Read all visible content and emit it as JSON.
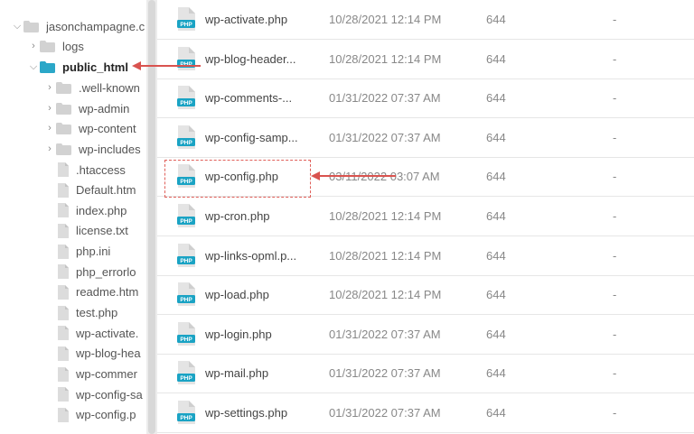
{
  "sidebar": {
    "root": "jasonchampagne.c",
    "logs": "logs",
    "public_html": "public_html",
    "folders": [
      ".well-known",
      "wp-admin",
      "wp-content",
      "wp-includes"
    ],
    "files": [
      ".htaccess",
      "Default.htm",
      "index.php",
      "license.txt",
      "php.ini",
      "php_errorlo",
      "readme.htm",
      "test.php",
      "wp-activate.",
      "wp-blog-hea",
      "wp-commer",
      "wp-config-sa",
      "wp-config.p"
    ]
  },
  "files": [
    {
      "name": "wp-activate.php",
      "date": "10/28/2021 12:14 PM",
      "perm": "644",
      "size": "-"
    },
    {
      "name": "wp-blog-header...",
      "date": "10/28/2021 12:14 PM",
      "perm": "644",
      "size": "-"
    },
    {
      "name": "wp-comments-...",
      "date": "01/31/2022 07:37 AM",
      "perm": "644",
      "size": "-"
    },
    {
      "name": "wp-config-samp...",
      "date": "01/31/2022 07:37 AM",
      "perm": "644",
      "size": "-"
    },
    {
      "name": "wp-config.php",
      "date": "03/11/2022 03:07 AM",
      "perm": "644",
      "size": "-"
    },
    {
      "name": "wp-cron.php",
      "date": "10/28/2021 12:14 PM",
      "perm": "644",
      "size": "-"
    },
    {
      "name": "wp-links-opml.p...",
      "date": "10/28/2021 12:14 PM",
      "perm": "644",
      "size": "-"
    },
    {
      "name": "wp-load.php",
      "date": "10/28/2021 12:14 PM",
      "perm": "644",
      "size": "-"
    },
    {
      "name": "wp-login.php",
      "date": "01/31/2022 07:37 AM",
      "perm": "644",
      "size": "-"
    },
    {
      "name": "wp-mail.php",
      "date": "01/31/2022 07:37 AM",
      "perm": "644",
      "size": "-"
    },
    {
      "name": "wp-settings.php",
      "date": "01/31/2022 07:37 AM",
      "perm": "644",
      "size": "-"
    }
  ],
  "icons": {
    "folder": "folder-icon",
    "file": "file-icon",
    "php": "php-file-icon",
    "chevron_right": "chevron-right-icon",
    "chevron_down": "chevron-down-icon"
  },
  "colors": {
    "folder_grey": "#d2d2d2",
    "folder_blue": "#2ba7c8",
    "php_badge": "#1aa3c4",
    "annotation_red": "#d9534f"
  },
  "php_badge_text": "PHP"
}
